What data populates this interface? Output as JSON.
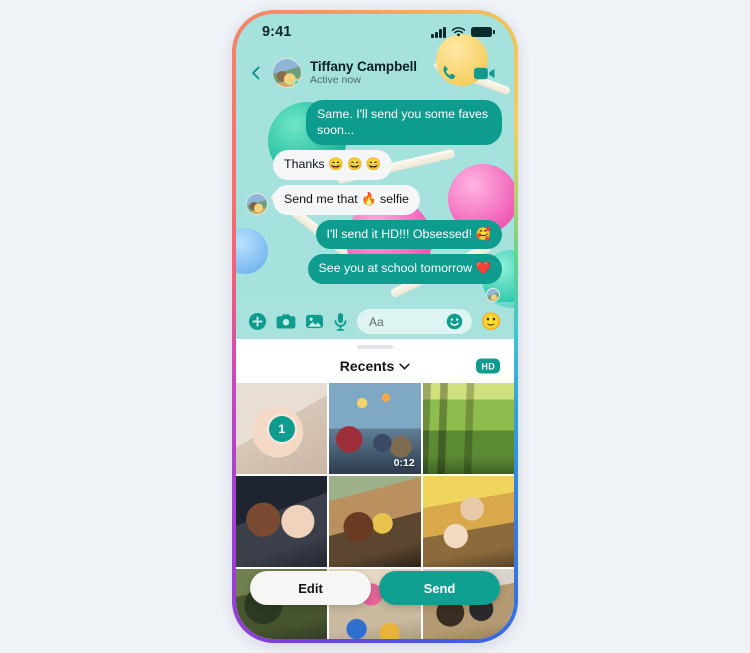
{
  "theme": {
    "page_bg": "#eff2f7",
    "accent_teal": "#0e9c8f",
    "chat_bg": "#a6e2dd",
    "incoming_bubble": "#f4f6f7",
    "frame_gradient": [
      "#9b3fd4",
      "#f0607a",
      "#f2a45f",
      "#5fd48a",
      "#2f8ee0",
      "#7b3fd4"
    ]
  },
  "status_bar": {
    "time": "9:41",
    "signal_icon": "cellular-signal-icon",
    "wifi_icon": "wifi-icon",
    "battery_icon": "battery-icon"
  },
  "chat_header": {
    "back_icon": "back-chevron-icon",
    "avatar": "contact-avatar",
    "presence": "online-dot",
    "name": "Tiffany Campbell",
    "status": "Active now",
    "call_icon": "phone-call-icon",
    "video_icon": "video-camera-icon"
  },
  "messages": [
    {
      "id": 1,
      "direction": "out",
      "text": "Same. I'll send you some faves soon..."
    },
    {
      "id": 2,
      "direction": "in",
      "text": "Thanks 😄 😄 😄",
      "show_avatar": false
    },
    {
      "id": 3,
      "direction": "in",
      "text": "Send me that 🔥 selfie",
      "show_avatar": true
    },
    {
      "id": 4,
      "direction": "out",
      "text": "I'll send it HD!!! Obsessed! 🥰"
    },
    {
      "id": 5,
      "direction": "out",
      "text": "See you at school tomorrow ❤️"
    }
  ],
  "read_receipt": {
    "avatar": "read-receipt-avatar"
  },
  "composer": {
    "add_icon": "plus-circle-icon",
    "camera_icon": "camera-icon",
    "gallery_icon": "image-icon",
    "mic_icon": "microphone-icon",
    "input_placeholder": "Aa",
    "sticker_icon": "smiley-face-icon",
    "emoji_button": "🙂"
  },
  "gallery": {
    "grabber": "sheet-drag-handle",
    "title": "Recents",
    "title_chevron": "chevron-down-icon",
    "hd_badge": "HD",
    "photos": [
      {
        "id": 1,
        "tile": "p1",
        "selected": true,
        "selection_number": "1",
        "duration": ""
      },
      {
        "id": 2,
        "tile": "p2",
        "selected": false,
        "selection_number": "",
        "duration": "0:12"
      },
      {
        "id": 3,
        "tile": "p3",
        "selected": false,
        "selection_number": "",
        "duration": ""
      },
      {
        "id": 4,
        "tile": "p4",
        "selected": false,
        "selection_number": "",
        "duration": ""
      },
      {
        "id": 5,
        "tile": "p5",
        "selected": false,
        "selection_number": "",
        "duration": ""
      },
      {
        "id": 6,
        "tile": "p6",
        "selected": false,
        "selection_number": "",
        "duration": ""
      },
      {
        "id": 7,
        "tile": "p7",
        "selected": false,
        "selection_number": "",
        "duration": ""
      },
      {
        "id": 8,
        "tile": "p8",
        "selected": false,
        "selection_number": "",
        "duration": ""
      },
      {
        "id": 9,
        "tile": "p9",
        "selected": false,
        "selection_number": "",
        "duration": ""
      }
    ]
  },
  "actions": {
    "edit_label": "Edit",
    "send_label": "Send"
  }
}
